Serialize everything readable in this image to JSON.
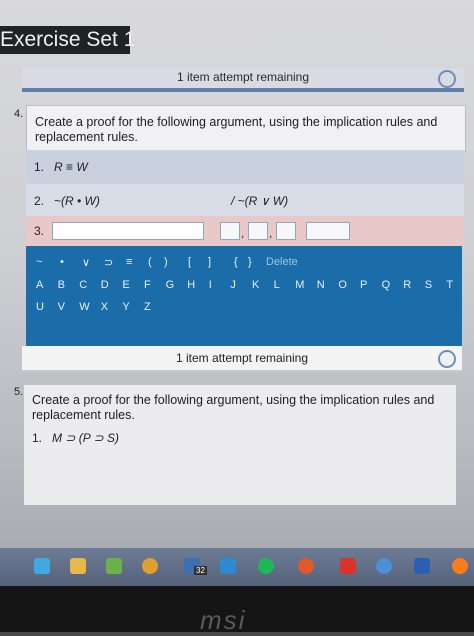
{
  "header": {
    "title": "Exercise Set 1"
  },
  "attempt_top": {
    "text": "1 item attempt remaining"
  },
  "question4": {
    "number": "4.",
    "text": "Create a proof for the following argument, using the implication rules and replacement rules.",
    "lines": [
      {
        "num": "1.",
        "expr": "R ≡ W"
      },
      {
        "num": "2.",
        "expr": "~(R • W)",
        "conclusion": "/ ~(R ∨ W)"
      },
      {
        "num": "3."
      }
    ],
    "keyboard": {
      "symbols": [
        "~",
        "•",
        "∨",
        "⊃",
        "≡",
        "(",
        ")",
        "[",
        "]",
        "{",
        "}"
      ],
      "delete_label": "Delete",
      "letters_row1": [
        "A",
        "B",
        "C",
        "D",
        "E",
        "F",
        "G",
        "H",
        "I",
        "J",
        "K",
        "L",
        "M",
        "N",
        "O",
        "P",
        "Q",
        "R",
        "S",
        "T"
      ],
      "letters_row2": [
        "U",
        "V",
        "W",
        "X",
        "Y",
        "Z"
      ]
    }
  },
  "attempt_bottom": {
    "text": "1 item attempt remaining"
  },
  "question5": {
    "number": "5.",
    "text": "Create a proof for the following argument, using the implication rules and replacement rules.",
    "lines": [
      {
        "num": "1.",
        "expr": "M ⊃ (P ⊃ S)"
      }
    ]
  },
  "taskbar": {
    "badge": "32"
  },
  "brand": "msi",
  "colors": {
    "keyboard": "#1a6da8",
    "title_bg": "#1f2226"
  }
}
